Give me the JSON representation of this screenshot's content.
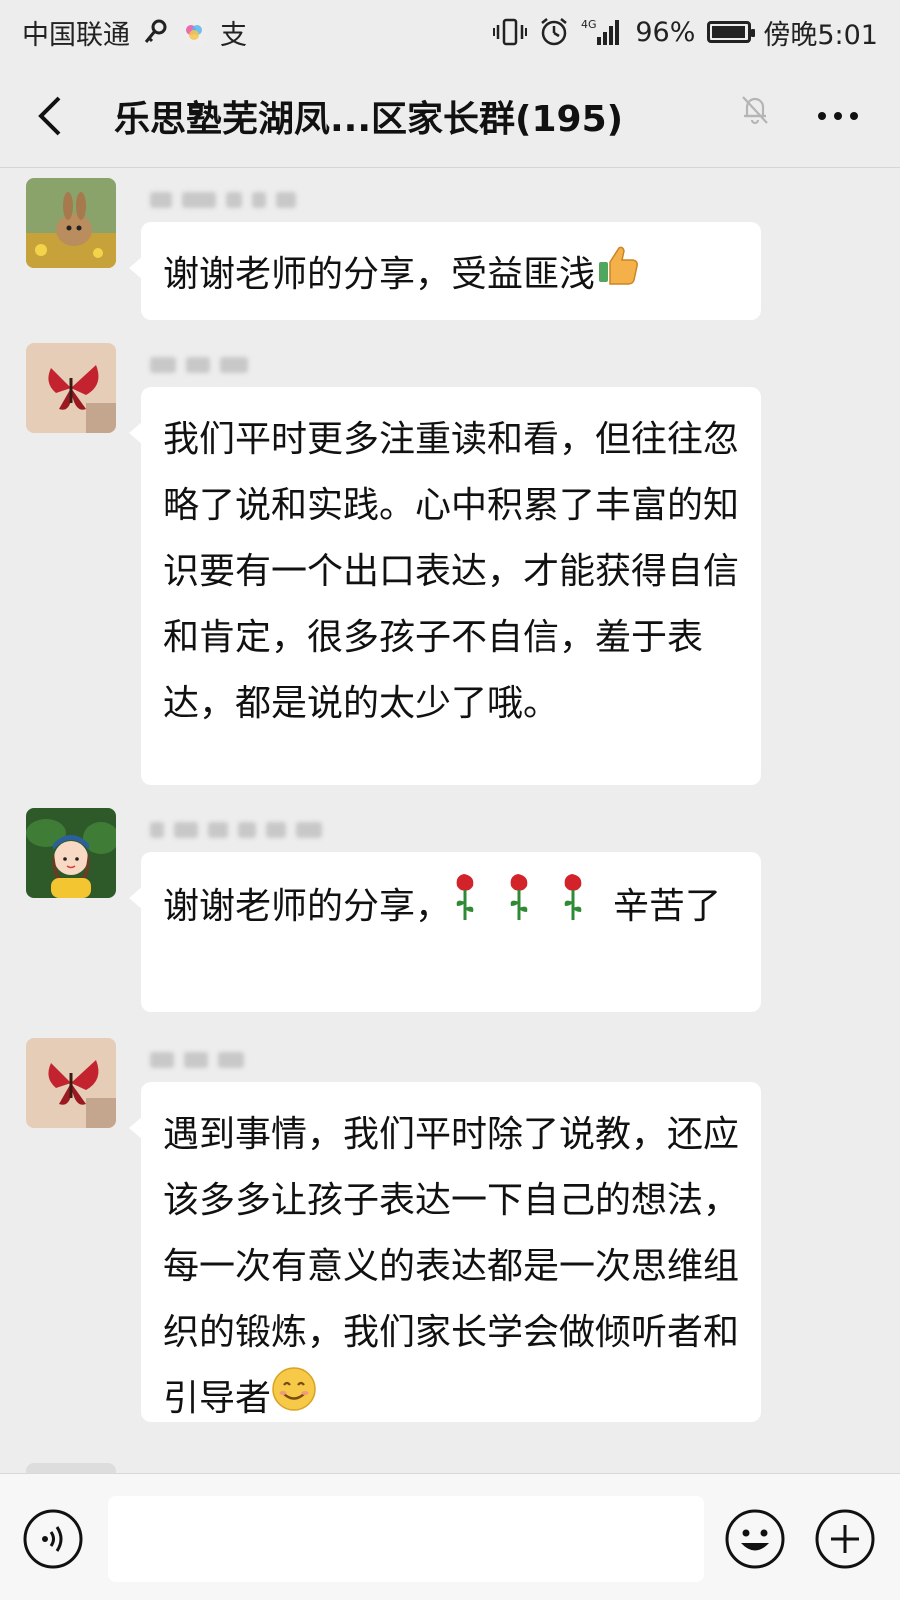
{
  "status_bar": {
    "carrier": "中国联通",
    "extra_app": "支",
    "network": "4G",
    "battery": "96%",
    "time": "傍晚5:01"
  },
  "nav": {
    "title": "乐思塾芜湖凤...区家长群(195)"
  },
  "messages": [
    {
      "avatar_icon": "rabbit-photo-avatar",
      "sender_name_blurred": true,
      "text": "谢谢老师的分享，受益匪浅",
      "emoji": "thumbs-up-icon"
    },
    {
      "avatar_icon": "butterfly-avatar",
      "sender_name_blurred": true,
      "text": "我们平时更多注重读和看，但往往忽略了说和实践。心中积累了丰富的知识要有一个出口表达，才能获得自信和肯定，很多孩子不自信，羞于表达，都是说的太少了哦。"
    },
    {
      "avatar_icon": "girl-cartoon-avatar",
      "sender_name_blurred": true,
      "text_before": "谢谢老师的分享，",
      "emoji": "rose-icon",
      "text_after": "辛苦了"
    },
    {
      "avatar_icon": "butterfly-avatar",
      "sender_name_blurred": true,
      "text": "遇到事情，我们平时除了说教，还应该多多让孩子表达一下自己的想法，每一次有意义的表达都是一次思维组织的锻炼，我们家长学会做倾听者和引导者",
      "emoji": "smile-icon"
    }
  ],
  "input_bar": {
    "placeholder": ""
  },
  "colors": {
    "background": "#ededed",
    "bubble": "#ffffff",
    "text": "#111111"
  }
}
